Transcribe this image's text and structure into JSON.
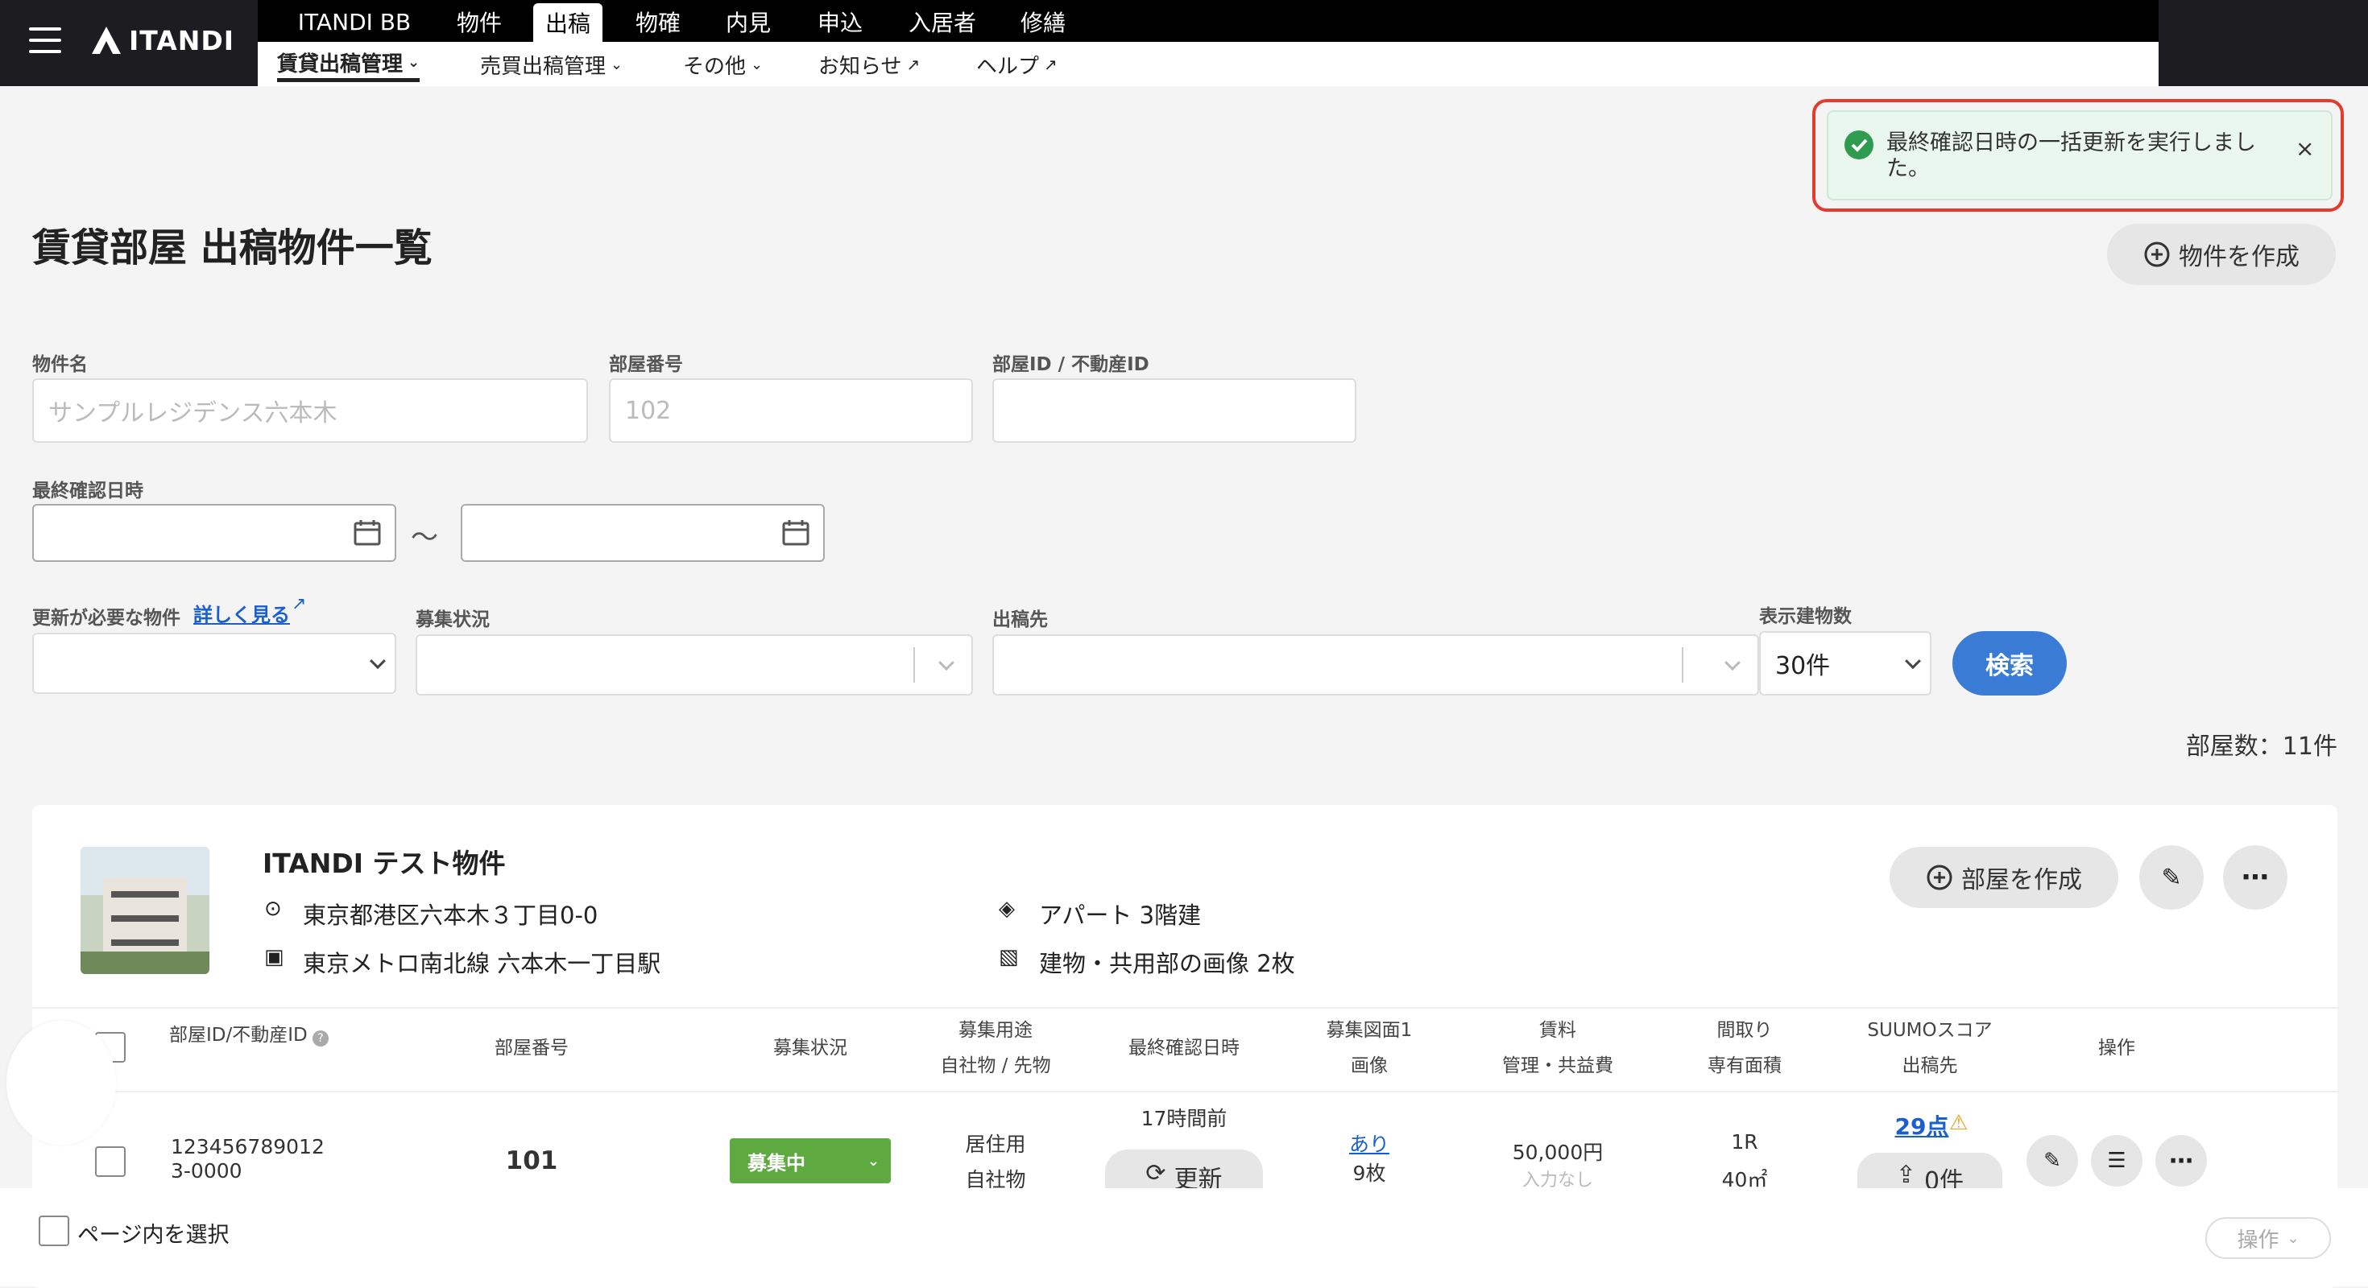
{
  "header": {
    "logo": "ITANDI",
    "top_tabs": [
      "ITANDI BB",
      "物件",
      "出稿",
      "物確",
      "内見",
      "申込",
      "入居者",
      "修繕"
    ],
    "sub_tabs": [
      "賃貸出稿管理",
      "売買出稿管理",
      "その他",
      "お知らせ",
      "ヘルプ"
    ]
  },
  "toast": {
    "message": "最終確認日時の一括更新を実行しました。",
    "status_color": "#2e9b4f"
  },
  "page": {
    "title": "賃貸部屋 出稿物件一覧",
    "create_property_label": "物件を作成"
  },
  "filters": {
    "property_name_label": "物件名",
    "property_name_placeholder": "サンプルレジデンス六本木",
    "room_number_label": "部屋番号",
    "room_number_placeholder": "102",
    "room_id_label": "部屋ID / 不動産ID",
    "last_confirmed_label": "最終確認日時",
    "range_separator": "〜",
    "update_needed_label": "更新が必要な物件",
    "detail_link": "詳しく見る",
    "recruit_status_label": "募集状況",
    "publish_to_label": "出稿先",
    "display_count_label": "表示建物数",
    "display_count_value": "30件",
    "search_label": "検索"
  },
  "room_count": "部屋数：11件",
  "property": {
    "name": "ITANDI テスト物件",
    "address": "東京都港区六本木３丁目0-0",
    "station": "東京メトロ南北線 六本木一丁目駅",
    "building": "アパート 3階建",
    "images": "建物・共用部の画像 2枚",
    "create_room_label": "部屋を作成"
  },
  "table": {
    "headers": {
      "room_id": "部屋ID/不動産ID",
      "room_number": "部屋番号",
      "status": "募集状況",
      "usage1": "募集用途",
      "usage2": "自社物 / 先物",
      "last_confirmed": "最終確認日時",
      "floorplan1": "募集図面1",
      "floorplan2": "画像",
      "rent1": "賃料",
      "rent2": "管理・共益費",
      "layout1": "間取り",
      "layout2": "専有面積",
      "suumo1": "SUUMOスコア",
      "suumo2": "出稿先",
      "ops": "操作"
    },
    "rows": [
      {
        "room_id": "123456789012 3-0000",
        "room_number": "101",
        "status": "募集中",
        "usage": "居住用",
        "ownership": "自社物",
        "last_confirmed": "17時間前",
        "update_label": "更新",
        "floorplan": "あり",
        "images": "9枚",
        "rent": "50,000円",
        "fee": "入力なし",
        "layout": "1R",
        "area": "40㎡",
        "suumo_score": "29点",
        "publish_count": "0件"
      }
    ]
  },
  "footer": {
    "select_page_label": "ページ内を選択",
    "ops_label": "操作"
  }
}
